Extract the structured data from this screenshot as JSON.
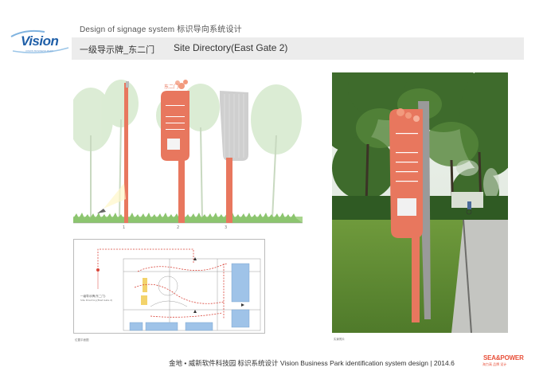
{
  "header": {
    "title": "Design of signage system  标识导向系统设计"
  },
  "logo": {
    "text": "Vision",
    "tagline": "VISION BUSINESS PARK"
  },
  "title_bar": {
    "title_cn": "一级导示牌_东二门",
    "title_en": "Site Directory(East Gate 2)"
  },
  "elevation": {
    "markers": [
      "1",
      "2",
      "3"
    ],
    "sign_top_label": "东二门"
  },
  "map": {
    "callout": "一级导示牌(东二门)",
    "callout_en": "Site Directory(East Gate 2)",
    "caption": "位置平面图"
  },
  "photo": {
    "caption": "实景照片"
  },
  "footer": {
    "text": "金地 • 威新软件科技园 标识系统设计  Vision Business Park  identification system design | 2014.6"
  },
  "brand": {
    "name": "SEA&POWER",
    "sub": "海力高 品牌 设计"
  },
  "colors": {
    "accent": "#e8775e",
    "sign_grey": "#c9c9c9",
    "tree_green": "#cfe3c6",
    "photo_green": "#3e6b2c"
  }
}
